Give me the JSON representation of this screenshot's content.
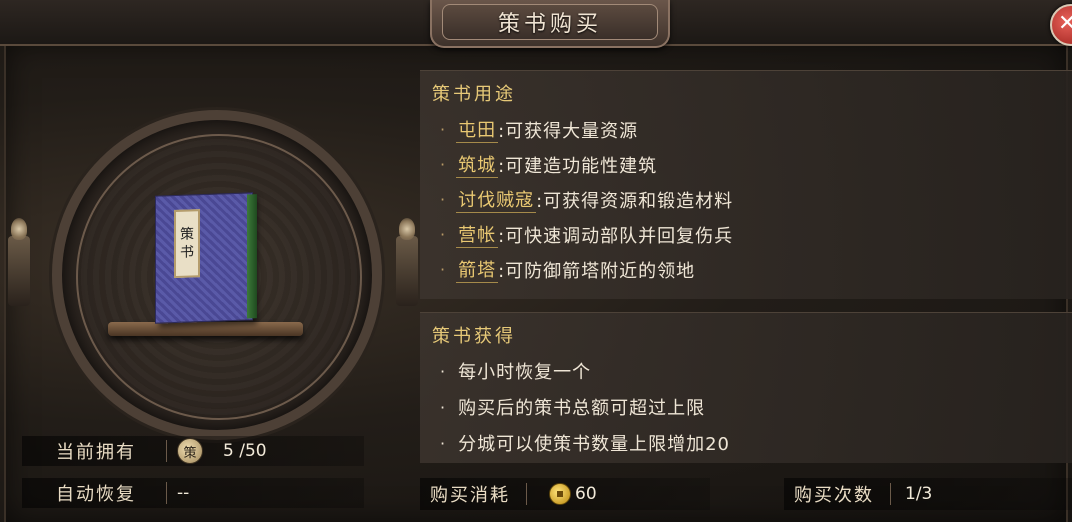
{
  "window": {
    "title": "策书购买",
    "close_label": "✕"
  },
  "book": {
    "label_chars": [
      "策",
      "书"
    ]
  },
  "stats": {
    "owned_label": "当前拥有",
    "owned_icon_char": "策",
    "owned_value": "5 /50",
    "auto_recover_label": "自动恢复",
    "auto_recover_value": "--"
  },
  "usage": {
    "title": "策书用途",
    "items": [
      {
        "keyword": "屯田",
        "desc": ":可获得大量资源"
      },
      {
        "keyword": "筑城",
        "desc": ":可建造功能性建筑"
      },
      {
        "keyword": "讨伐贼寇",
        "desc": ":可获得资源和锻造材料"
      },
      {
        "keyword": "营帐",
        "desc": ":可快速调动部队并回复伤兵"
      },
      {
        "keyword": "箭塔",
        "desc": ":可防御箭塔附近的领地"
      }
    ]
  },
  "obtain": {
    "title": "策书获得",
    "items": [
      "每小时恢复一个",
      "购买后的策书总额可超过上限",
      "分城可以使策书数量上限增加20"
    ]
  },
  "purchase": {
    "cost_label": "购买消耗",
    "cost_value": "60",
    "count_label": "购买次数",
    "count_value": "1/3"
  },
  "colors": {
    "keyword": "#e9c872",
    "section_title": "#e7c978",
    "text": "#efe6d6"
  },
  "icons": {
    "close": "close-icon",
    "coin": "gold-coin-icon",
    "book": "strategy-book-icon"
  }
}
